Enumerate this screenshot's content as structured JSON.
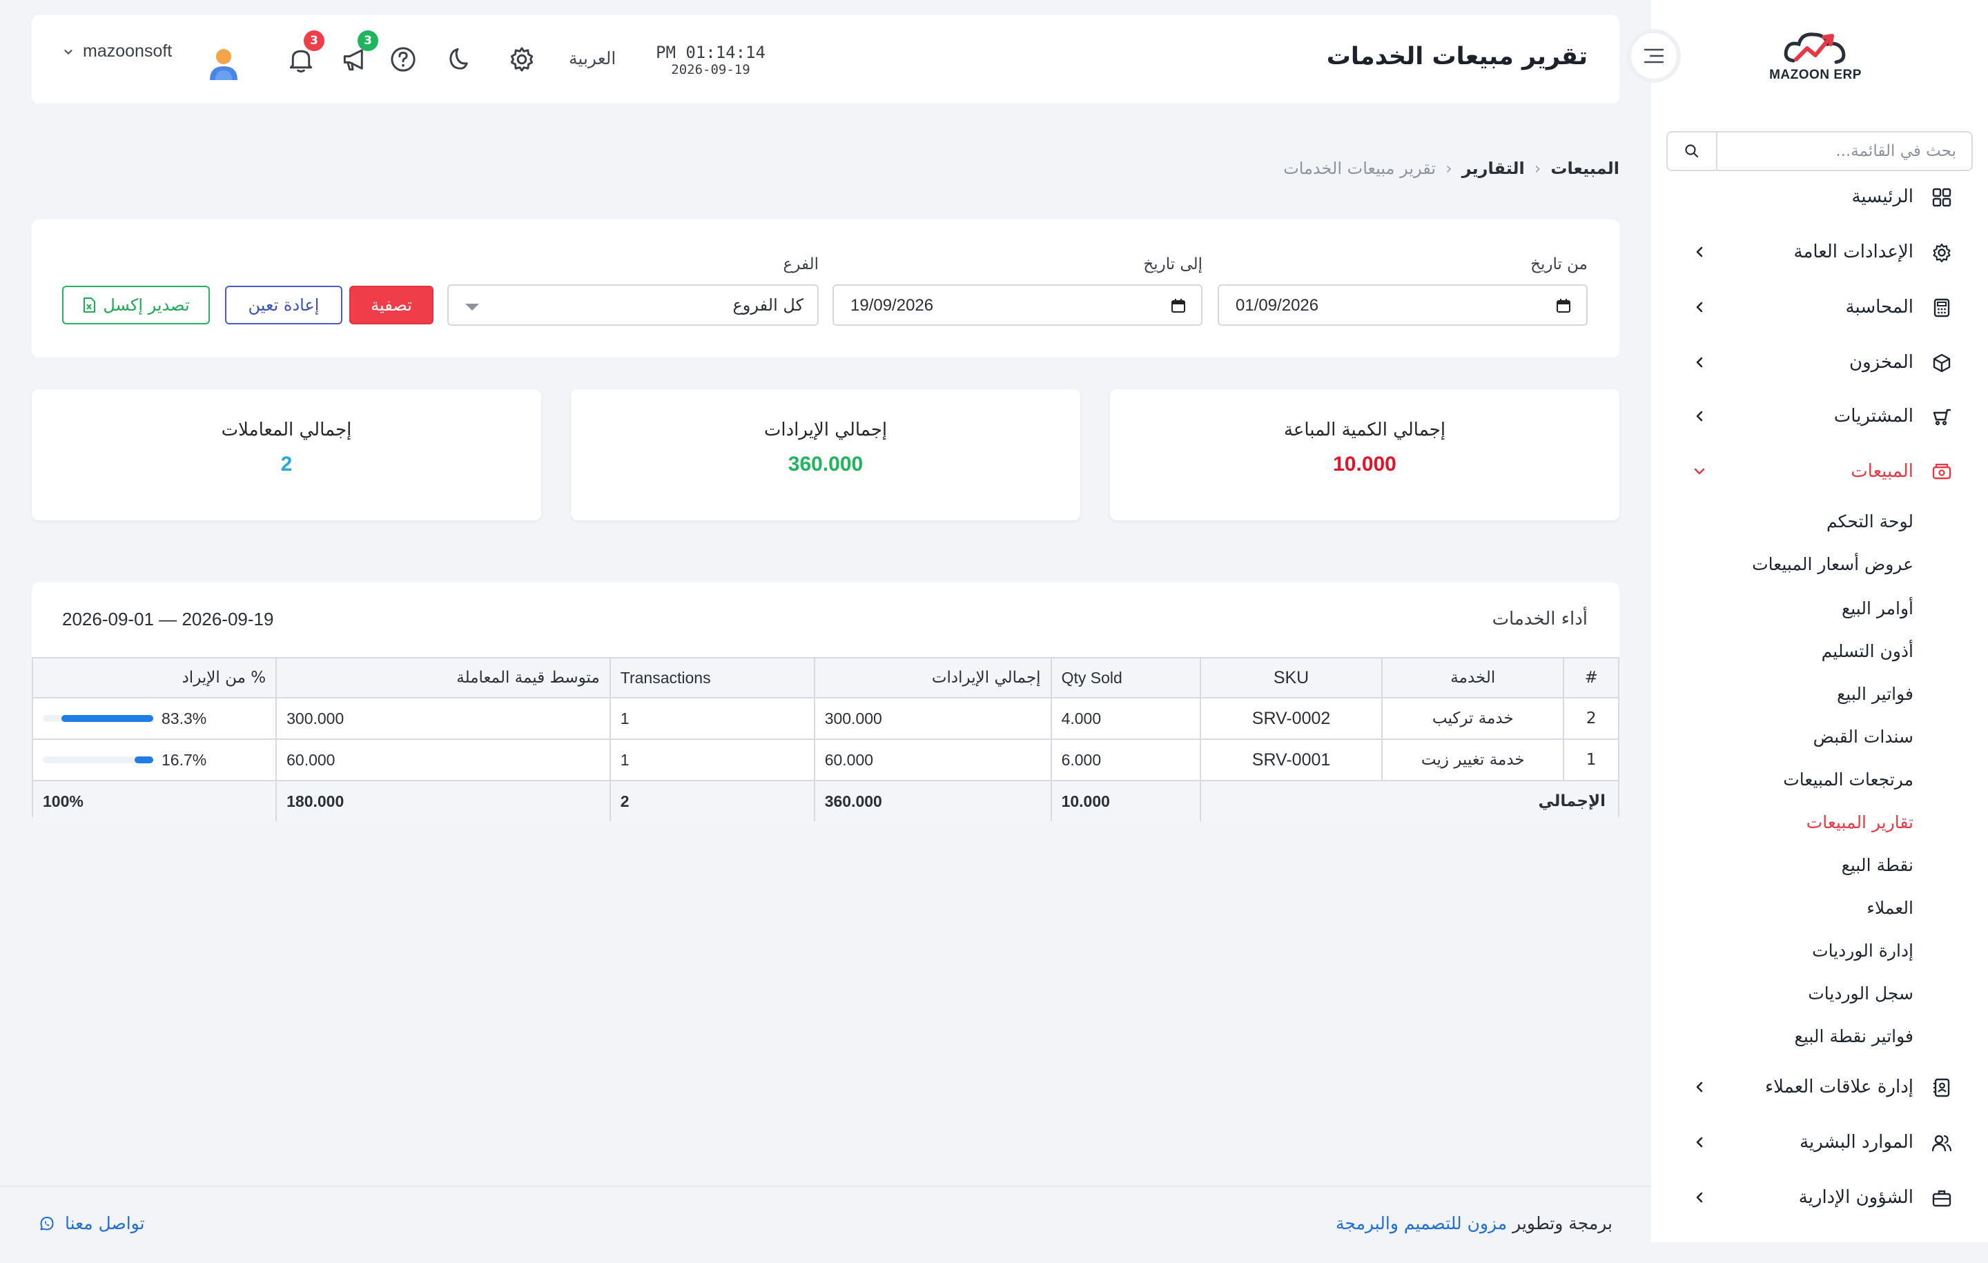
{
  "header": {
    "title": "تقرير مبيعات الخدمات",
    "time": "PM 01:14:14",
    "date": "2026-09-19",
    "language": "العربية",
    "notifications_count": "3",
    "announcements_count": "3",
    "username": "mazoonsoft"
  },
  "sidebar": {
    "logo_text": "MAZOON ERP",
    "search_placeholder": "بحث في القائمة...",
    "items": [
      {
        "label": "الرئيسية"
      },
      {
        "label": "الإعدادات العامة"
      },
      {
        "label": "المحاسبة"
      },
      {
        "label": "المخزون"
      },
      {
        "label": "المشتريات"
      },
      {
        "label": "المبيعات"
      },
      {
        "label": "إدارة علاقات العملاء"
      },
      {
        "label": "الموارد البشرية"
      },
      {
        "label": "الشؤون الإدارية"
      }
    ],
    "sales_sub": [
      "لوحة التحكم",
      "عروض أسعار المبيعات",
      "أوامر البيع",
      "أذون التسليم",
      "فواتير البيع",
      "سندات القبض",
      "مرتجعات المبيعات",
      "تقارير المبيعات",
      "نقطة البيع",
      "العملاء",
      "إدارة الورديات",
      "سجل الورديات",
      "فواتير نقطة البيع"
    ]
  },
  "breadcrumb": {
    "level1": "المبيعات",
    "level2": "التقارير",
    "current": "تقرير مبيعات الخدمات"
  },
  "filters": {
    "from_label": "من تاريخ",
    "from_value": "01/09/2026",
    "to_label": "إلى تاريخ",
    "to_value": "19/09/2026",
    "branch_label": "الفرع",
    "branch_value": "كل الفروع",
    "filter_button": "تصفية",
    "reset_button": "إعادة تعين",
    "export_button": "تصدير إكسل"
  },
  "stats": {
    "qty_label": "إجمالي الكمية المباعة",
    "qty_value": "10.000",
    "qty_color": "#e0152b",
    "revenue_label": "إجمالي الإيرادات",
    "revenue_value": "360.000",
    "revenue_color": "#1fb45e",
    "trans_label": "إجمالي المعاملات",
    "trans_value": "2",
    "trans_color": "#26a9d4"
  },
  "table": {
    "title": "أداء الخدمات",
    "range": "2026-09-01 — 2026-09-19",
    "headers": {
      "num": "#",
      "service": "الخدمة",
      "sku": "SKU",
      "qty": "Qty Sold",
      "revenue": "إجمالي الإيرادات",
      "transactions": "Transactions",
      "avg": "متوسط قيمة المعاملة",
      "pct": "% من الإيراد"
    },
    "rows": [
      {
        "num": "2",
        "service": "خدمة تركيب",
        "sku": "SRV-0002",
        "qty": "4.000",
        "revenue": "300.000",
        "transactions": "1",
        "avg": "300.000",
        "pct": "83.3%",
        "pct_value": 83.3
      },
      {
        "num": "1",
        "service": "خدمة تغيير زيت",
        "sku": "SRV-0001",
        "qty": "6.000",
        "revenue": "60.000",
        "transactions": "1",
        "avg": "60.000",
        "pct": "16.7%",
        "pct_value": 16.7
      }
    ],
    "total": {
      "label": "الإجمالي",
      "qty": "10.000",
      "revenue": "360.000",
      "transactions": "2",
      "avg": "180.000",
      "pct": "100%"
    }
  },
  "footer": {
    "prefix": "برمجة وتطوير",
    "brand": "مزون للتصميم والبرمجة",
    "contact": "تواصل معنا"
  }
}
